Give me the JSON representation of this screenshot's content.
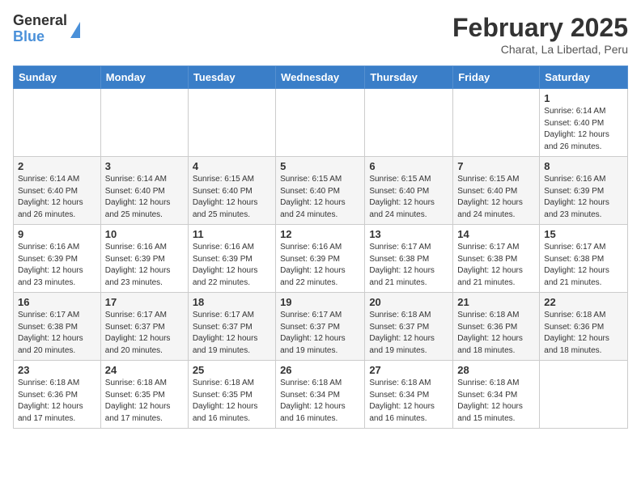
{
  "header": {
    "logo_general": "General",
    "logo_blue": "Blue",
    "month_title": "February 2025",
    "location": "Charat, La Libertad, Peru"
  },
  "weekdays": [
    "Sunday",
    "Monday",
    "Tuesday",
    "Wednesday",
    "Thursday",
    "Friday",
    "Saturday"
  ],
  "weeks": [
    [
      {
        "day": "",
        "info": ""
      },
      {
        "day": "",
        "info": ""
      },
      {
        "day": "",
        "info": ""
      },
      {
        "day": "",
        "info": ""
      },
      {
        "day": "",
        "info": ""
      },
      {
        "day": "",
        "info": ""
      },
      {
        "day": "1",
        "info": "Sunrise: 6:14 AM\nSunset: 6:40 PM\nDaylight: 12 hours\nand 26 minutes."
      }
    ],
    [
      {
        "day": "2",
        "info": "Sunrise: 6:14 AM\nSunset: 6:40 PM\nDaylight: 12 hours\nand 26 minutes."
      },
      {
        "day": "3",
        "info": "Sunrise: 6:14 AM\nSunset: 6:40 PM\nDaylight: 12 hours\nand 25 minutes."
      },
      {
        "day": "4",
        "info": "Sunrise: 6:15 AM\nSunset: 6:40 PM\nDaylight: 12 hours\nand 25 minutes."
      },
      {
        "day": "5",
        "info": "Sunrise: 6:15 AM\nSunset: 6:40 PM\nDaylight: 12 hours\nand 24 minutes."
      },
      {
        "day": "6",
        "info": "Sunrise: 6:15 AM\nSunset: 6:40 PM\nDaylight: 12 hours\nand 24 minutes."
      },
      {
        "day": "7",
        "info": "Sunrise: 6:15 AM\nSunset: 6:40 PM\nDaylight: 12 hours\nand 24 minutes."
      },
      {
        "day": "8",
        "info": "Sunrise: 6:16 AM\nSunset: 6:39 PM\nDaylight: 12 hours\nand 23 minutes."
      }
    ],
    [
      {
        "day": "9",
        "info": "Sunrise: 6:16 AM\nSunset: 6:39 PM\nDaylight: 12 hours\nand 23 minutes."
      },
      {
        "day": "10",
        "info": "Sunrise: 6:16 AM\nSunset: 6:39 PM\nDaylight: 12 hours\nand 23 minutes."
      },
      {
        "day": "11",
        "info": "Sunrise: 6:16 AM\nSunset: 6:39 PM\nDaylight: 12 hours\nand 22 minutes."
      },
      {
        "day": "12",
        "info": "Sunrise: 6:16 AM\nSunset: 6:39 PM\nDaylight: 12 hours\nand 22 minutes."
      },
      {
        "day": "13",
        "info": "Sunrise: 6:17 AM\nSunset: 6:38 PM\nDaylight: 12 hours\nand 21 minutes."
      },
      {
        "day": "14",
        "info": "Sunrise: 6:17 AM\nSunset: 6:38 PM\nDaylight: 12 hours\nand 21 minutes."
      },
      {
        "day": "15",
        "info": "Sunrise: 6:17 AM\nSunset: 6:38 PM\nDaylight: 12 hours\nand 21 minutes."
      }
    ],
    [
      {
        "day": "16",
        "info": "Sunrise: 6:17 AM\nSunset: 6:38 PM\nDaylight: 12 hours\nand 20 minutes."
      },
      {
        "day": "17",
        "info": "Sunrise: 6:17 AM\nSunset: 6:37 PM\nDaylight: 12 hours\nand 20 minutes."
      },
      {
        "day": "18",
        "info": "Sunrise: 6:17 AM\nSunset: 6:37 PM\nDaylight: 12 hours\nand 19 minutes."
      },
      {
        "day": "19",
        "info": "Sunrise: 6:17 AM\nSunset: 6:37 PM\nDaylight: 12 hours\nand 19 minutes."
      },
      {
        "day": "20",
        "info": "Sunrise: 6:18 AM\nSunset: 6:37 PM\nDaylight: 12 hours\nand 19 minutes."
      },
      {
        "day": "21",
        "info": "Sunrise: 6:18 AM\nSunset: 6:36 PM\nDaylight: 12 hours\nand 18 minutes."
      },
      {
        "day": "22",
        "info": "Sunrise: 6:18 AM\nSunset: 6:36 PM\nDaylight: 12 hours\nand 18 minutes."
      }
    ],
    [
      {
        "day": "23",
        "info": "Sunrise: 6:18 AM\nSunset: 6:36 PM\nDaylight: 12 hours\nand 17 minutes."
      },
      {
        "day": "24",
        "info": "Sunrise: 6:18 AM\nSunset: 6:35 PM\nDaylight: 12 hours\nand 17 minutes."
      },
      {
        "day": "25",
        "info": "Sunrise: 6:18 AM\nSunset: 6:35 PM\nDaylight: 12 hours\nand 16 minutes."
      },
      {
        "day": "26",
        "info": "Sunrise: 6:18 AM\nSunset: 6:34 PM\nDaylight: 12 hours\nand 16 minutes."
      },
      {
        "day": "27",
        "info": "Sunrise: 6:18 AM\nSunset: 6:34 PM\nDaylight: 12 hours\nand 16 minutes."
      },
      {
        "day": "28",
        "info": "Sunrise: 6:18 AM\nSunset: 6:34 PM\nDaylight: 12 hours\nand 15 minutes."
      },
      {
        "day": "",
        "info": ""
      }
    ]
  ]
}
